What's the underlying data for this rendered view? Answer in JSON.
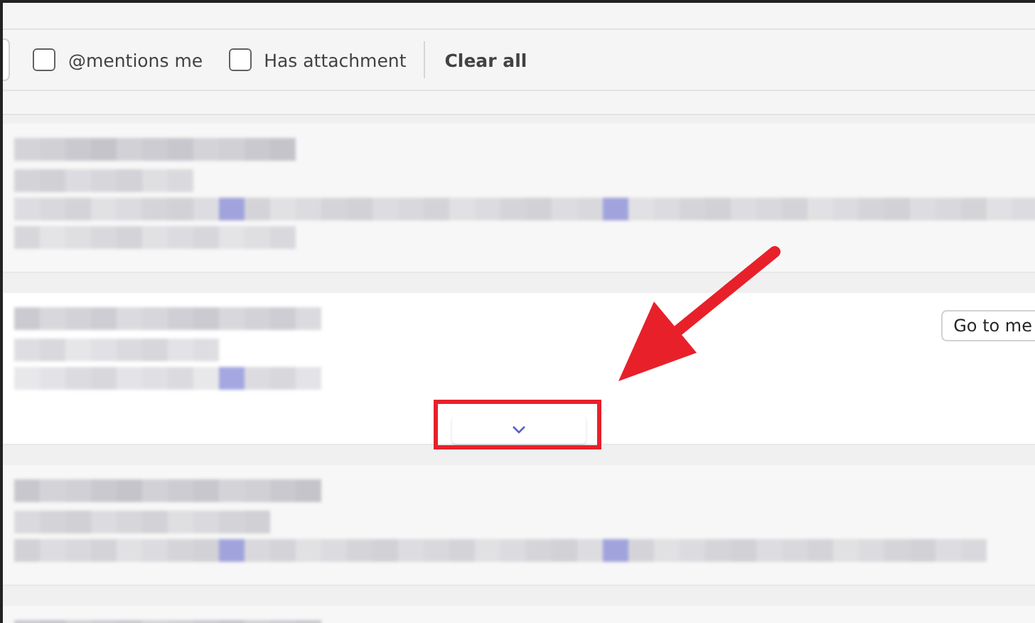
{
  "filters": [
    {
      "label": "@mentions me",
      "checked": false
    },
    {
      "label": "Has attachment",
      "checked": false
    }
  ],
  "clear_all": "Clear all",
  "results": [
    {
      "hovered": false
    },
    {
      "hovered": true,
      "action": "Go to me"
    },
    {
      "hovered": false
    },
    {
      "hovered": false
    }
  ],
  "expand_button": {
    "shown": true
  }
}
